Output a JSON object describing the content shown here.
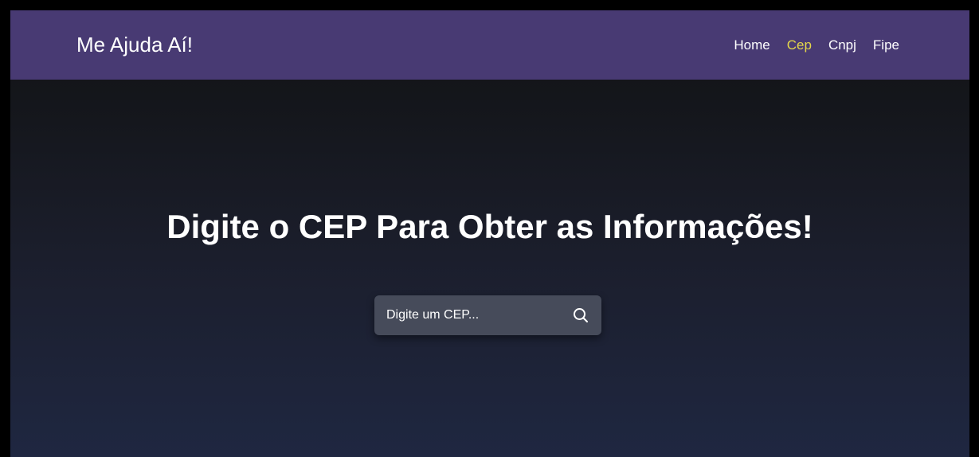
{
  "header": {
    "brand": "Me Ajuda Aí!",
    "nav": [
      {
        "label": "Home",
        "active": false
      },
      {
        "label": "Cep",
        "active": true
      },
      {
        "label": "Cnpj",
        "active": false
      },
      {
        "label": "Fipe",
        "active": false
      }
    ]
  },
  "main": {
    "title": "Digite o CEP Para Obter as Informações!",
    "search": {
      "placeholder": "Digite um CEP...",
      "value": "",
      "icon": "search-icon"
    }
  },
  "colors": {
    "navbar_bg": "#483a73",
    "active_link": "#e4d64a",
    "search_bg": "#464b5a",
    "text": "#ffffff"
  }
}
